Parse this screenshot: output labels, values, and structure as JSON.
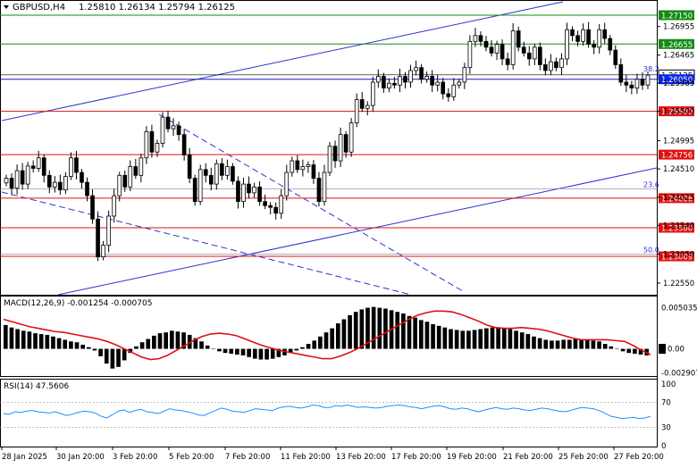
{
  "header": {
    "symbol": "GBPUSD,H4",
    "ohlc": "1.25810 1.26134 1.25794 1.26125"
  },
  "price_axis": {
    "ticks": [
      "1.26955",
      "1.26465",
      "1.25985",
      "1.25500",
      "1.24995",
      "1.24510",
      "1.24025",
      "1.23540",
      "1.23050",
      "1.22550"
    ]
  },
  "horizontal_levels": [
    {
      "label": "1.27150",
      "value": 1.2715,
      "color": "#138a13",
      "style": "green"
    },
    {
      "label": "1.26655",
      "value": 1.26655,
      "color": "#138a13",
      "style": "green"
    },
    {
      "label": "1.26125",
      "value": 1.26125,
      "color": "#000000",
      "style": "current"
    },
    {
      "label": "1.26050",
      "value": 1.2605,
      "color": "#1a1acc",
      "style": "blue"
    },
    {
      "label": "1.25500",
      "value": 1.255,
      "color": "#e01010",
      "style": "red"
    },
    {
      "label": "1.24756",
      "value": 1.24756,
      "color": "#e01010",
      "style": "red"
    },
    {
      "label": "1.24008",
      "value": 1.24008,
      "color": "#e01010",
      "style": "red"
    },
    {
      "label": "1.23500",
      "value": 1.235,
      "color": "#e01010",
      "style": "red"
    },
    {
      "label": "1.23009",
      "value": 1.23009,
      "color": "#e01010",
      "style": "red"
    }
  ],
  "fib_labels": [
    {
      "label": "38.2",
      "value": 1.2615
    },
    {
      "label": "23.6",
      "value": 1.2417
    },
    {
      "label": "50.0",
      "value": 1.2305
    }
  ],
  "macd": {
    "title": "MACD(12,26,9) -0.001254 -0.000705",
    "ticks": [
      "0.005035",
      "0.00",
      "-0.002907"
    ]
  },
  "rsi": {
    "title": "RSI(14) 47.5606",
    "ticks": [
      "100",
      "70",
      "30",
      "0"
    ]
  },
  "time_axis": {
    "labels": [
      "28 Jan 2025",
      "30 Jan 20:00",
      "3 Feb 20:00",
      "5 Feb 20:00",
      "7 Feb 20:00",
      "11 Feb 20:00",
      "13 Feb 20:00",
      "17 Feb 20:00",
      "19 Feb 20:00",
      "21 Feb 20:00",
      "25 Feb 20:00",
      "27 Feb 20:00"
    ]
  },
  "colors": {
    "candle": "#000000",
    "bull_body": "#ffffff",
    "bear_body": "#000000",
    "channel": "#3030d0",
    "signal": "#e01010",
    "rsi_line": "#1e90ff",
    "current_price_box": "#0a24e8"
  },
  "chart_data": {
    "type": "candlestick",
    "symbol": "GBPUSD,H4",
    "price_range": [
      1.2235,
      1.2738
    ],
    "closes": [
      1.2435,
      1.2418,
      1.2448,
      1.2425,
      1.2456,
      1.2452,
      1.247,
      1.244,
      1.242,
      1.2428,
      1.2415,
      1.2438,
      1.247,
      1.2445,
      1.2428,
      1.2405,
      1.2365,
      1.23,
      1.232,
      1.237,
      1.2405,
      1.244,
      1.242,
      1.2455,
      1.244,
      1.247,
      1.2515,
      1.248,
      1.2495,
      1.254,
      1.252,
      1.2525,
      1.251,
      1.2475,
      1.2435,
      1.2395,
      1.245,
      1.244,
      1.2425,
      1.246,
      1.244,
      1.2455,
      1.243,
      1.2395,
      1.2425,
      1.241,
      1.242,
      1.2395,
      1.2388,
      1.2385,
      1.2375,
      1.2405,
      1.2445,
      1.2465,
      1.245,
      1.2455,
      1.2458,
      1.2435,
      1.2395,
      1.2445,
      1.249,
      1.2465,
      1.251,
      1.248,
      1.253,
      1.257,
      1.2555,
      1.256,
      1.26,
      1.261,
      1.259,
      1.2598,
      1.2595,
      1.261,
      1.26,
      1.262,
      1.2625,
      1.2605,
      1.261,
      1.2595,
      1.26,
      1.258,
      1.2575,
      1.2595,
      1.26,
      1.2625,
      1.267,
      1.268,
      1.267,
      1.266,
      1.265,
      1.2665,
      1.264,
      1.263,
      1.2688,
      1.266,
      1.265,
      1.264,
      1.266,
      1.263,
      1.262,
      1.2635,
      1.2625,
      1.264,
      1.269,
      1.268,
      1.267,
      1.269,
      1.2665,
      1.266,
      1.269,
      1.2675,
      1.2655,
      1.263,
      1.26,
      1.2595,
      1.259,
      1.2605,
      1.2595,
      1.2612
    ],
    "macd": {
      "range": [
        -0.0032,
        0.0055
      ],
      "histogram": [
        0.0029,
        0.0026,
        0.0024,
        0.0022,
        0.0021,
        0.0019,
        0.0018,
        0.0017,
        0.0015,
        0.0013,
        0.0011,
        0.0009,
        0.0008,
        0.0005,
        0.0002,
        -0.0002,
        -0.0009,
        -0.0018,
        -0.0024,
        -0.0022,
        -0.0014,
        -0.0005,
        0.0003,
        0.0008,
        0.0012,
        0.0016,
        0.0019,
        0.002,
        0.0022,
        0.0021,
        0.002,
        0.0017,
        0.0013,
        0.0009,
        0.0004,
        0.0,
        -0.0003,
        -0.0005,
        -0.0006,
        -0.0007,
        -0.0008,
        -0.001,
        -0.0012,
        -0.0013,
        -0.0013,
        -0.0012,
        -0.001,
        -0.0008,
        -0.0005,
        -0.0002,
        0.0002,
        0.0006,
        0.001,
        0.0015,
        0.002,
        0.0025,
        0.0031,
        0.0036,
        0.0041,
        0.0045,
        0.0048,
        0.005,
        0.0051,
        0.005,
        0.0049,
        0.0047,
        0.0045,
        0.0043,
        0.004,
        0.0038,
        0.0035,
        0.0033,
        0.003,
        0.0028,
        0.0026,
        0.0024,
        0.0023,
        0.0022,
        0.0022,
        0.0023,
        0.0024,
        0.0025,
        0.0026,
        0.0026,
        0.0025,
        0.0024,
        0.0022,
        0.002,
        0.0018,
        0.0015,
        0.0013,
        0.0011,
        0.001,
        0.001,
        0.0011,
        0.0011,
        0.0012,
        0.0011,
        0.0011,
        0.001,
        0.0009,
        0.0006,
        0.0003,
        0.0,
        -0.0003,
        -0.0005,
        -0.0006,
        -0.0007,
        -0.0008
      ],
      "signal": [
        0.0036,
        0.0033,
        0.003,
        0.0027,
        0.0025,
        0.0023,
        0.0021,
        0.002,
        0.0018,
        0.0016,
        0.0014,
        0.0012,
        0.0009,
        0.0005,
        0.0,
        -0.0005,
        -0.001,
        -0.0013,
        -0.0012,
        -0.0008,
        -0.0002,
        0.0004,
        0.001,
        0.0015,
        0.0018,
        0.0019,
        0.0018,
        0.0016,
        0.0012,
        0.0008,
        0.0004,
        0.0001,
        -0.0002,
        -0.0004,
        -0.0006,
        -0.0008,
        -0.001,
        -0.0012,
        -0.0012,
        -0.0009,
        -0.0005,
        0.0,
        0.0006,
        0.0012,
        0.0018,
        0.0024,
        0.003,
        0.0036,
        0.0041,
        0.0044,
        0.0046,
        0.0046,
        0.0045,
        0.0042,
        0.0038,
        0.0034,
        0.0029,
        0.0026,
        0.0025,
        0.0025,
        0.0026,
        0.0025,
        0.0024,
        0.0022,
        0.0019,
        0.0016,
        0.0013,
        0.0011,
        0.0011,
        0.0011,
        0.0011,
        0.001,
        0.0009,
        0.0004,
        -0.0002,
        -0.0007
      ]
    },
    "rsi": {
      "range": [
        0,
        100
      ],
      "levels": [
        70,
        30
      ],
      "values": [
        52,
        51,
        55,
        54,
        56,
        57,
        55,
        54,
        53,
        55,
        52,
        49,
        51,
        54,
        56,
        55,
        53,
        48,
        45,
        50,
        56,
        58,
        54,
        57,
        59,
        55,
        54,
        52,
        56,
        60,
        58,
        57,
        55,
        53,
        50,
        49,
        53,
        57,
        61,
        59,
        56,
        55,
        54,
        57,
        60,
        59,
        58,
        57,
        61,
        63,
        64,
        62,
        61,
        63,
        66,
        65,
        62,
        62,
        65,
        64,
        66,
        64,
        62,
        63,
        62,
        61,
        62,
        64,
        65,
        66,
        65,
        63,
        62,
        60,
        62,
        64,
        65,
        63,
        60,
        59,
        61,
        60,
        57,
        55,
        58,
        60,
        62,
        60,
        59,
        61,
        60,
        58,
        57,
        59,
        61,
        60,
        58,
        56,
        55,
        57,
        60,
        62,
        61,
        60,
        57,
        53,
        48,
        46,
        44,
        45,
        46,
        44,
        45,
        47.5
      ]
    }
  }
}
